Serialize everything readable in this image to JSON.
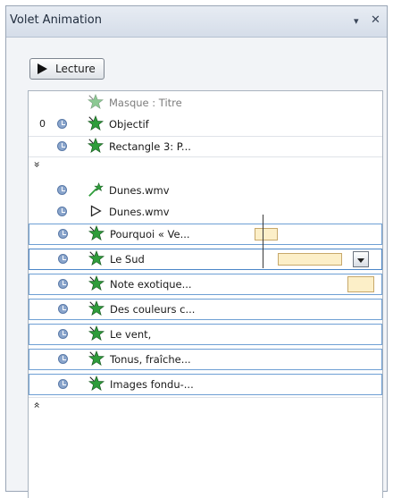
{
  "pane": {
    "title": "Volet Animation",
    "dropdown_glyph": "▾",
    "close_glyph": "✕"
  },
  "play_button": {
    "label": "Lecture",
    "icon": "play-icon"
  },
  "rows": [
    {
      "index": "",
      "timing_icon": "",
      "effect": "star-green",
      "label": "Masque : Titre",
      "style": "dim"
    },
    {
      "index": "0",
      "timing_icon": "clock-icon",
      "effect": "star-green",
      "label": "Objectif",
      "style": "none"
    },
    {
      "index": "",
      "timing_icon": "clock-icon",
      "effect": "star-green",
      "label": "Rectangle 3: P...",
      "style": "plain"
    },
    {
      "index": "",
      "timing_icon": "",
      "effect": "expand-chevron",
      "label": "",
      "style": "collapse",
      "glyph": "»"
    },
    {
      "index": "",
      "timing_icon": "clock-icon",
      "effect": "star-pen",
      "label": "Dunes.wmv",
      "style": "none"
    },
    {
      "index": "",
      "timing_icon": "clock-icon",
      "effect": "play-outline",
      "label": "Dunes.wmv",
      "style": "none"
    },
    {
      "index": "",
      "timing_icon": "clock-icon",
      "effect": "star-green",
      "label": "Pourquoi « Ve...",
      "style": "boxed"
    },
    {
      "index": "",
      "timing_icon": "clock-icon",
      "effect": "star-green",
      "label": "Le Sud",
      "style": "selected"
    },
    {
      "index": "",
      "timing_icon": "clock-icon",
      "effect": "star-green",
      "label": "Note exotique...",
      "style": "boxed"
    },
    {
      "index": "",
      "timing_icon": "clock-icon",
      "effect": "star-green",
      "label": "Des couleurs c...",
      "style": "boxed"
    },
    {
      "index": "",
      "timing_icon": "clock-icon",
      "effect": "star-green",
      "label": "Le vent,",
      "style": "boxed"
    },
    {
      "index": "",
      "timing_icon": "clock-icon",
      "effect": "star-green",
      "label": "Tonus, fraîche...",
      "style": "boxed"
    },
    {
      "index": "",
      "timing_icon": "clock-icon",
      "effect": "star-green",
      "label": "Images fondu-...",
      "style": "boxed"
    },
    {
      "index": "",
      "timing_icon": "",
      "effect": "collapse-chevron",
      "label": "",
      "style": "collapse",
      "glyph": "«"
    }
  ],
  "colors": {
    "accent_border": "#6e9fd4",
    "timeline_bar": "#fcefc8",
    "star_green": "#2e9d3a",
    "clock_blue": "#8aa5cc"
  }
}
